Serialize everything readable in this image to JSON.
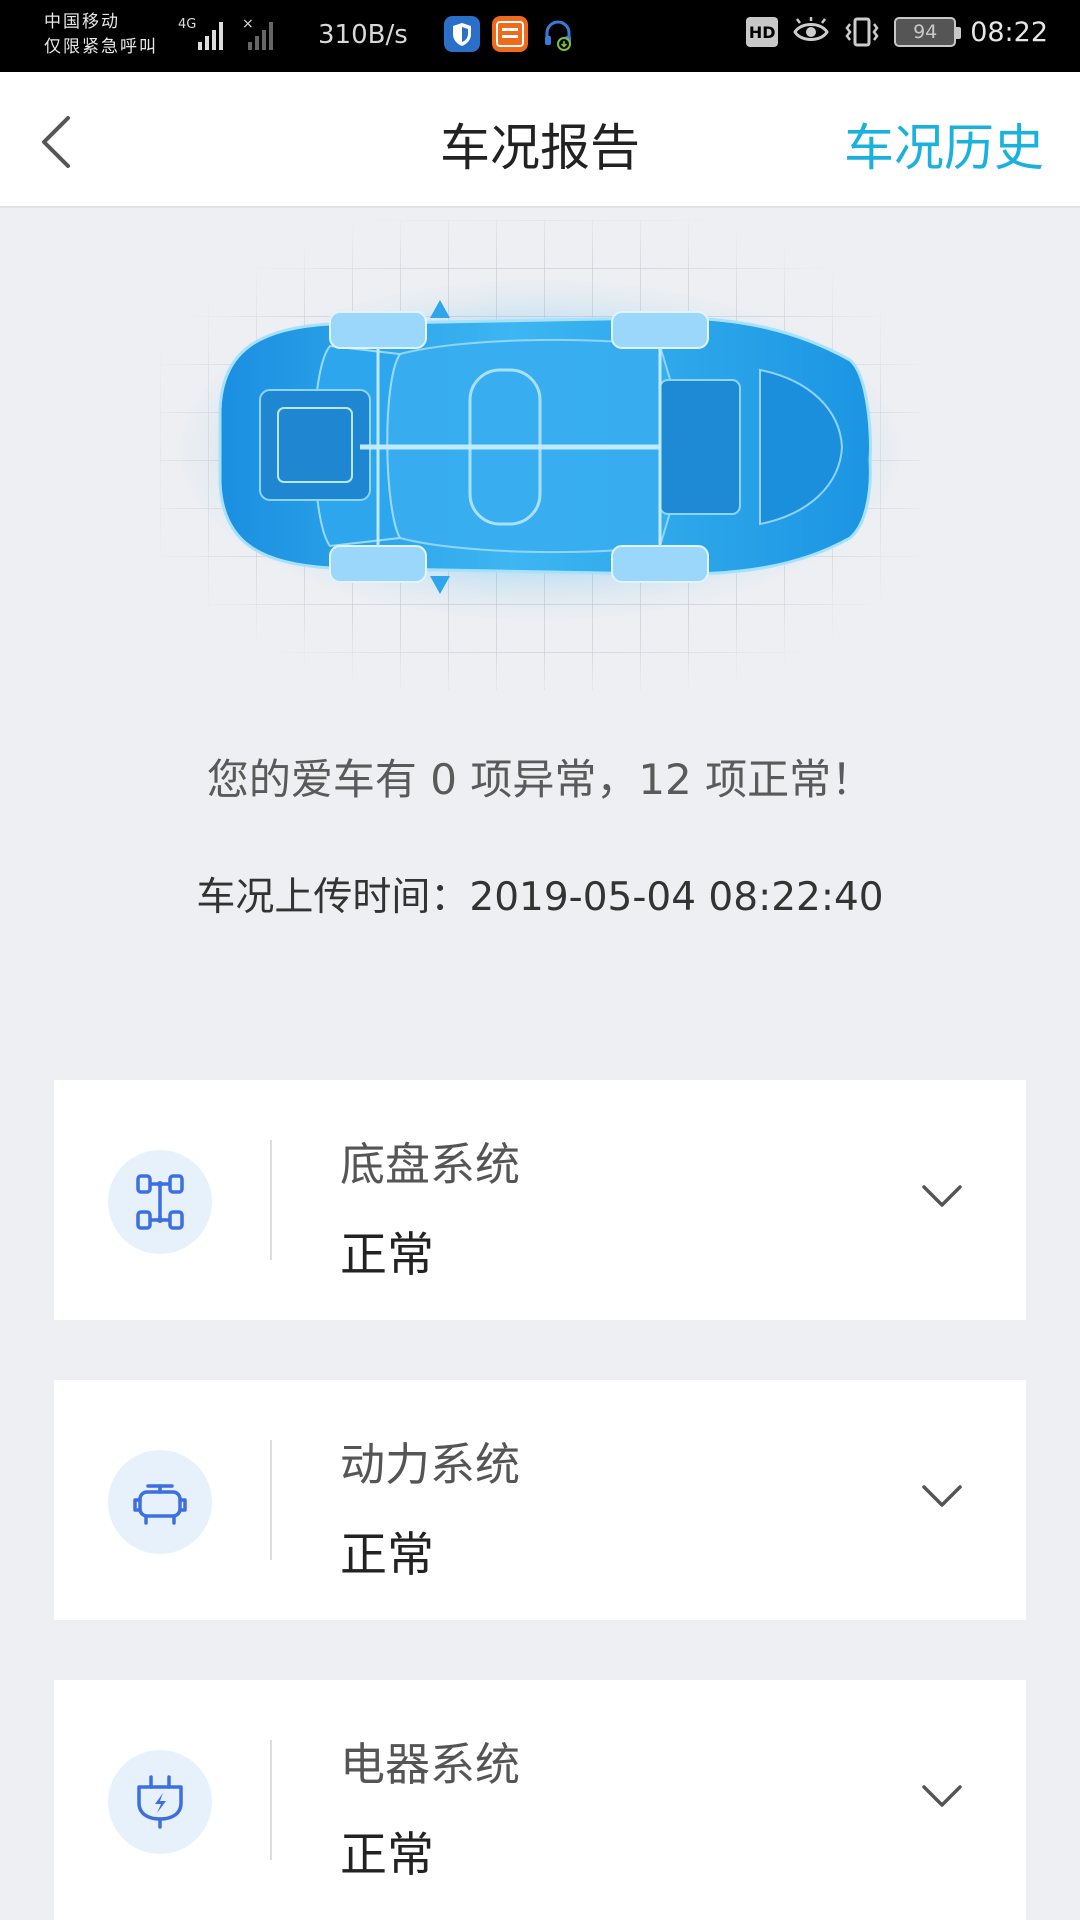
{
  "status_bar": {
    "carrier_line1": "中国移动",
    "carrier_line2": "仅限紧急呼叫",
    "network": "4G",
    "speed": "310B/s",
    "hd": "HD",
    "battery": "94",
    "time": "08:22",
    "app_icons": [
      "shield-app-icon",
      "pingan-bank-app-icon",
      "headset-download-icon"
    ]
  },
  "nav": {
    "title": "车况报告",
    "history_label": "车况历史"
  },
  "report": {
    "summary": "您的爱车有 0 项异常，12 项正常！",
    "upload_time": "车况上传时间：2019-05-04 08:22:40"
  },
  "systems": [
    {
      "name": "底盘系统",
      "status": "正常",
      "icon": "chassis-icon"
    },
    {
      "name": "动力系统",
      "status": "正常",
      "icon": "engine-icon"
    },
    {
      "name": "电器系统",
      "status": "正常",
      "icon": "electrical-plug-icon"
    }
  ],
  "colors": {
    "accent": "#1ab1dd",
    "icon_blue": "#3d6fe0",
    "car_blue": "#1c9fe6",
    "background": "#eeeff2"
  }
}
